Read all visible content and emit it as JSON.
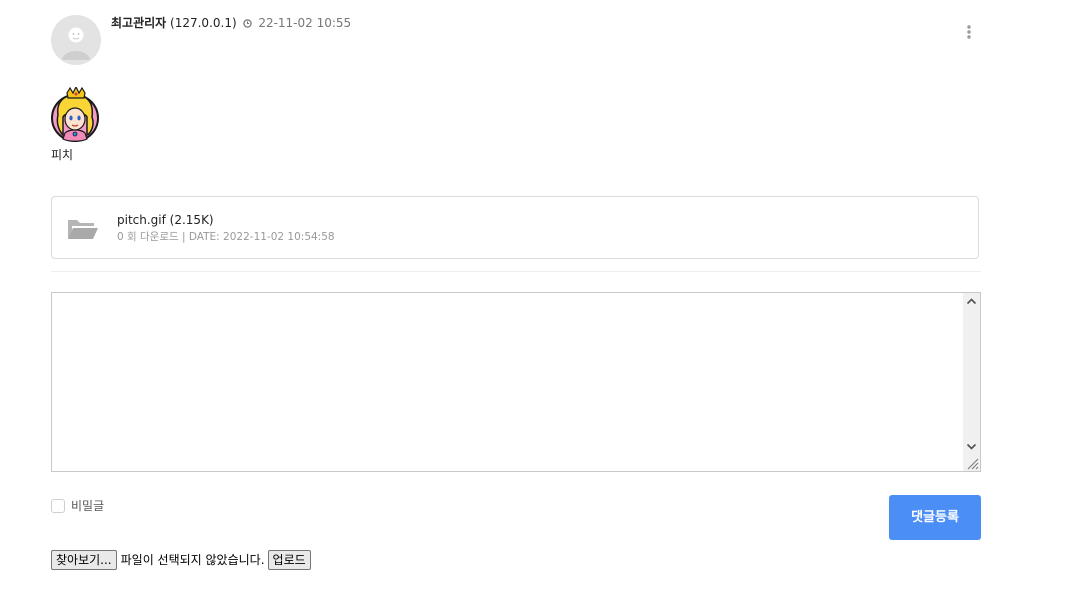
{
  "post": {
    "author": "최고관리자",
    "ip": "(127.0.0.1)",
    "date": "22-11-02 10:55"
  },
  "content": {
    "caption": "피치"
  },
  "attachment": {
    "file_line": "pitch.gif (2.15K)",
    "info": "0 회 다운로드 | DATE: 2022-11-02 10:54:58"
  },
  "comment_form": {
    "textarea_value": "",
    "secret_label": "비밀글",
    "submit_label": "댓글등록",
    "browse_label": "찾아보기...",
    "no_file_text": "파일이 선택되지 않았습니다.",
    "upload_label": "업로드"
  },
  "colors": {
    "accent": "#4b8ef6",
    "border": "#dcdcdc",
    "muted": "#999999"
  }
}
